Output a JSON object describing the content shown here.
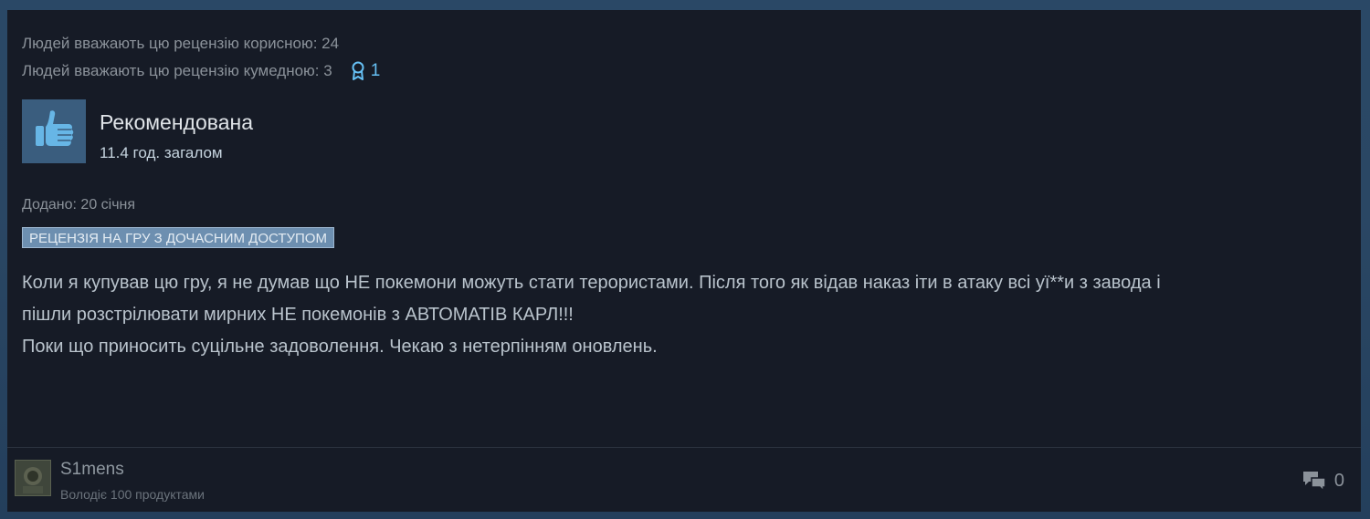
{
  "votes": {
    "helpful": "Людей вважають цю рецензію корисною: 24",
    "funny": "Людей вважають цю рецензію кумедною: 3",
    "awards_count": "1"
  },
  "recommendation": {
    "title": "Рекомендована",
    "hours": "11.4 год. загалом"
  },
  "posted": "Додано: 20 січня",
  "early_access_badge": "РЕЦЕНЗІЯ НА ГРУ З ДОЧАСНИМ ДОСТУПОМ",
  "review": {
    "line1": "Коли я купував цю гру, я не думав що НЕ покемони можуть стати терористами. Після того як відав наказ іти в атаку всі уї**и з завода і",
    "line2": "пішли розстрілювати мирних НЕ покемонів з АВТОМАТІВ КАРЛ!!!",
    "line3": "Поки що приносить суцільне задоволення. Чекаю з нетерпінням оновлень."
  },
  "author": {
    "name": "S1mens",
    "products": "Володіє 100 продуктами"
  },
  "comments_count": "0",
  "icons": {
    "award": "award-icon",
    "thumb": "thumbs-up-icon",
    "comments": "comment-bubbles-icon"
  },
  "colors": {
    "accent": "#66c0f4",
    "card_bg": "#161b26",
    "badge_bg": "#6d8fb0"
  }
}
